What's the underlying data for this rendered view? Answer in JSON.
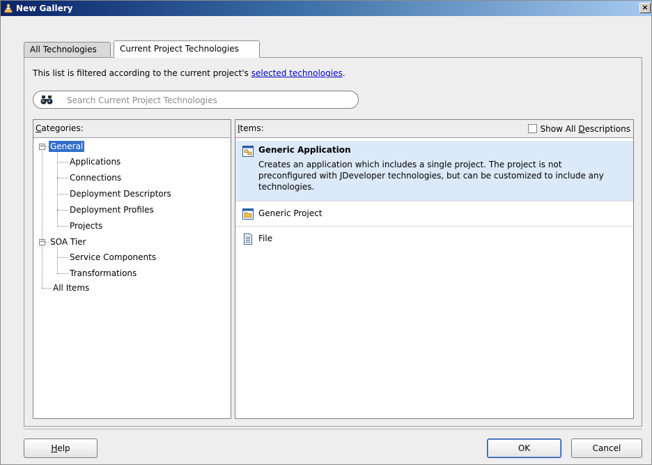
{
  "window": {
    "title": "New Gallery",
    "close_symbol": "×"
  },
  "tabs": [
    {
      "label": "All Technologies",
      "active": false
    },
    {
      "label": "Current Project Technologies",
      "active": true
    }
  ],
  "filter": {
    "prefix": "This list is filtered according to the current project's ",
    "link": "selected technologies",
    "suffix": "."
  },
  "search": {
    "placeholder": "Search Current Project Technologies",
    "icon": "binoculars-icon"
  },
  "categories": {
    "header_u": "C",
    "header_rest": "ategories:",
    "tree": [
      {
        "label": "General",
        "level": 0,
        "expanded": true,
        "selected": true
      },
      {
        "label": "Applications",
        "level": 1
      },
      {
        "label": "Connections",
        "level": 1
      },
      {
        "label": "Deployment Descriptors",
        "level": 1
      },
      {
        "label": "Deployment Profiles",
        "level": 1
      },
      {
        "label": "Projects",
        "level": 1
      },
      {
        "label": "SOA Tier",
        "level": 0,
        "expanded": true,
        "selected": false
      },
      {
        "label": "Service Components",
        "level": 1
      },
      {
        "label": "Transformations",
        "level": 1
      },
      {
        "label": "All Items",
        "level": 0
      }
    ]
  },
  "items": {
    "header_u": "I",
    "header_rest": "tems:",
    "show_all_prefix": "Show All ",
    "show_all_u": "D",
    "show_all_rest": "escriptions",
    "show_all_checked": false,
    "list": [
      {
        "title": "Generic Application",
        "description": "Creates an application which includes a single project. The project is not preconfigured with JDeveloper technologies, but can be customized to include any technologies.",
        "icon": "application-icon",
        "selected": true
      },
      {
        "title": "Generic Project",
        "icon": "project-icon",
        "selected": false
      },
      {
        "title": "File",
        "icon": "file-icon",
        "selected": false
      }
    ]
  },
  "buttons": {
    "help_u": "H",
    "help_rest": "elp",
    "ok": "OK",
    "cancel": "Cancel"
  },
  "colors": {
    "selection": "#3470c8",
    "selected_item_bg": "#dbe9f8",
    "link": "#0000cc"
  }
}
